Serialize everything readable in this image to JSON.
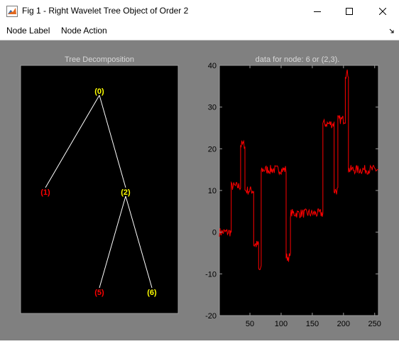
{
  "window": {
    "title": "Fig 1 - Right Wavelet Tree Object of Order 2",
    "icon": "matlab-figure-icon"
  },
  "menu": {
    "items": [
      "Node Label",
      "Node Action"
    ]
  },
  "tree_panel": {
    "title": "Tree Decomposition",
    "nodes": [
      {
        "label": "(0)",
        "color": "#ffff00"
      },
      {
        "label": "(1)",
        "color": "#ff0000"
      },
      {
        "label": "(2)",
        "color": "#ffff00"
      },
      {
        "label": "(5)",
        "color": "#ff0000"
      },
      {
        "label": "(6)",
        "color": "#ffff00"
      }
    ],
    "edges": [
      [
        "(0)",
        "(1)"
      ],
      [
        "(0)",
        "(2)"
      ],
      [
        "(2)",
        "(5)"
      ],
      [
        "(2)",
        "(6)"
      ]
    ]
  },
  "colors": {
    "figure_bg": "#808080",
    "axes_bg": "#000000",
    "signal": "#ff0000",
    "selected_node": "#ffff00",
    "other_node": "#ff0000"
  },
  "chart_data": {
    "type": "line",
    "title": "data for node: 6 or (2,3).",
    "xlim": [
      1,
      256
    ],
    "ylim": [
      -20,
      40
    ],
    "x_ticks": [
      50,
      100,
      150,
      200,
      250
    ],
    "y_ticks": [
      -20,
      -10,
      0,
      10,
      20,
      30,
      40
    ],
    "grid": false,
    "color": "#ff0000",
    "segments": [
      {
        "x_start": 1,
        "x_end": 20,
        "level": 0
      },
      {
        "x_start": 20,
        "x_end": 35,
        "level": 11
      },
      {
        "x_start": 35,
        "x_end": 42,
        "level": 21
      },
      {
        "x_start": 42,
        "x_end": 56,
        "level": 10
      },
      {
        "x_start": 56,
        "x_end": 64,
        "level": -3
      },
      {
        "x_start": 64,
        "x_end": 68,
        "level": -9
      },
      {
        "x_start": 68,
        "x_end": 108,
        "level": 15
      },
      {
        "x_start": 108,
        "x_end": 115,
        "level": -6
      },
      {
        "x_start": 115,
        "x_end": 167,
        "level": 4.5
      },
      {
        "x_start": 167,
        "x_end": 185,
        "level": 26
      },
      {
        "x_start": 185,
        "x_end": 191,
        "level": 10
      },
      {
        "x_start": 191,
        "x_end": 203,
        "level": 27
      },
      {
        "x_start": 203,
        "x_end": 208,
        "level": 38
      },
      {
        "x_start": 208,
        "x_end": 256,
        "level": 15
      }
    ]
  }
}
